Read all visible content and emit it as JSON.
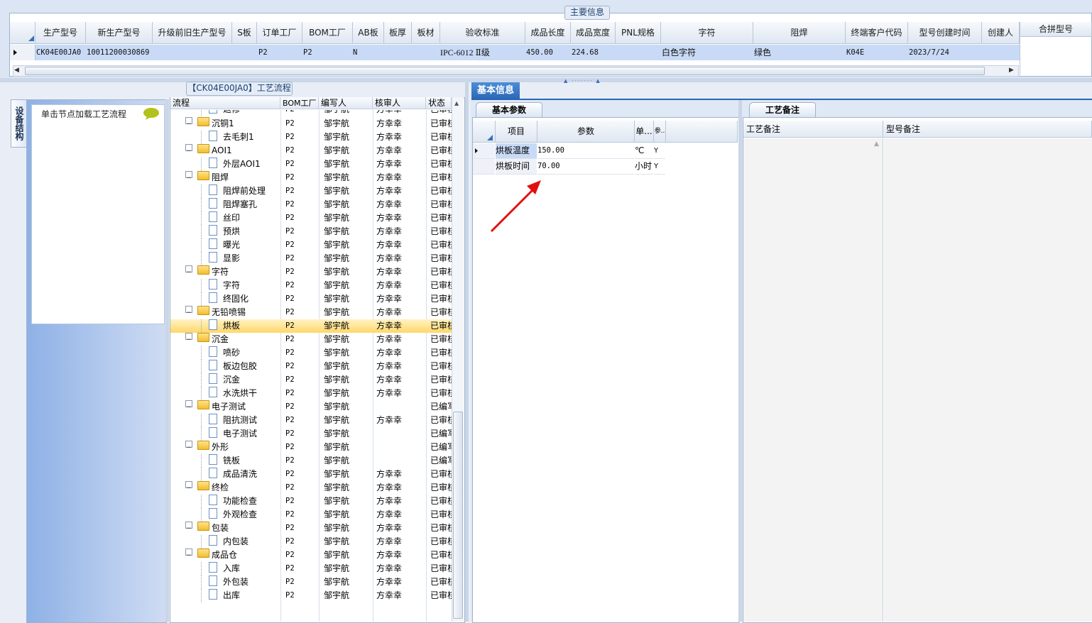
{
  "main_info": {
    "legend": "主要信息",
    "columns": [
      "生产型号",
      "新生产型号",
      "升级前旧生产型号",
      "S板",
      "订单工厂",
      "BOM工厂",
      "AB板",
      "板厚",
      "板材",
      "验收标准",
      "成品长度",
      "成品宽度",
      "PNL规格",
      "字符",
      "阻焊",
      "终端客户代码",
      "型号创建时间",
      "创建人"
    ],
    "row": {
      "production_model": "CK04E00JA0",
      "new_production_model": "10011200030869",
      "order_factory": "P2",
      "bom_factory": "P2",
      "ab_board": "N",
      "acceptance_standard": "IPC-6012 Ⅱ级",
      "length": "450.00",
      "width": "224.68",
      "character": "白色字符",
      "solder_mask": "绿色",
      "customer_code": "K04E",
      "created": "2023/7/24"
    },
    "merge_model_header": "合拼型号"
  },
  "left_panel": {
    "tab_label": "设备结构",
    "hint": "单击节点加载工艺流程"
  },
  "process_flow": {
    "legend": "【CK04E00JA0】工艺流程",
    "columns": [
      "流程",
      "BOM工厂",
      "编写人",
      "核审人",
      "状态"
    ],
    "rows": [
      {
        "level": 2,
        "type": "doc",
        "name": "返修",
        "bom": "P2",
        "writer": "邹宇航",
        "reviewer": "方幸幸",
        "status": "已审核",
        "partial": true
      },
      {
        "level": 1,
        "type": "folder",
        "name": "沉铜1",
        "bom": "P2",
        "writer": "邹宇航",
        "reviewer": "方幸幸",
        "status": "已审核"
      },
      {
        "level": 2,
        "type": "doc",
        "name": "去毛刺1",
        "bom": "P2",
        "writer": "邹宇航",
        "reviewer": "方幸幸",
        "status": "已审核"
      },
      {
        "level": 1,
        "type": "folder",
        "name": "AOI1",
        "bom": "P2",
        "writer": "邹宇航",
        "reviewer": "方幸幸",
        "status": "已审核"
      },
      {
        "level": 2,
        "type": "doc",
        "name": "外层AOI1",
        "bom": "P2",
        "writer": "邹宇航",
        "reviewer": "方幸幸",
        "status": "已审核"
      },
      {
        "level": 1,
        "type": "folder",
        "name": "阻焊",
        "bom": "P2",
        "writer": "邹宇航",
        "reviewer": "方幸幸",
        "status": "已审核"
      },
      {
        "level": 2,
        "type": "doc",
        "name": "阻焊前处理",
        "bom": "P2",
        "writer": "邹宇航",
        "reviewer": "方幸幸",
        "status": "已审核"
      },
      {
        "level": 2,
        "type": "doc",
        "name": "阻焊塞孔",
        "bom": "P2",
        "writer": "邹宇航",
        "reviewer": "方幸幸",
        "status": "已审核"
      },
      {
        "level": 2,
        "type": "doc",
        "name": "丝印",
        "bom": "P2",
        "writer": "邹宇航",
        "reviewer": "方幸幸",
        "status": "已审核"
      },
      {
        "level": 2,
        "type": "doc",
        "name": "预烘",
        "bom": "P2",
        "writer": "邹宇航",
        "reviewer": "方幸幸",
        "status": "已审核"
      },
      {
        "level": 2,
        "type": "doc",
        "name": "曝光",
        "bom": "P2",
        "writer": "邹宇航",
        "reviewer": "方幸幸",
        "status": "已审核"
      },
      {
        "level": 2,
        "type": "doc",
        "name": "显影",
        "bom": "P2",
        "writer": "邹宇航",
        "reviewer": "方幸幸",
        "status": "已审核"
      },
      {
        "level": 1,
        "type": "folder",
        "name": "字符",
        "bom": "P2",
        "writer": "邹宇航",
        "reviewer": "方幸幸",
        "status": "已审核"
      },
      {
        "level": 2,
        "type": "doc",
        "name": "字符",
        "bom": "P2",
        "writer": "邹宇航",
        "reviewer": "方幸幸",
        "status": "已审核"
      },
      {
        "level": 2,
        "type": "doc",
        "name": "终固化",
        "bom": "P2",
        "writer": "邹宇航",
        "reviewer": "方幸幸",
        "status": "已审核"
      },
      {
        "level": 1,
        "type": "folder",
        "name": "无铅喷锡",
        "bom": "P2",
        "writer": "邹宇航",
        "reviewer": "方幸幸",
        "status": "已审核"
      },
      {
        "level": 2,
        "type": "doc",
        "name": "烘板",
        "bom": "P2",
        "writer": "邹宇航",
        "reviewer": "方幸幸",
        "status": "已审核",
        "selected": true
      },
      {
        "level": 1,
        "type": "folder",
        "name": "沉金",
        "bom": "P2",
        "writer": "邹宇航",
        "reviewer": "方幸幸",
        "status": "已审核"
      },
      {
        "level": 2,
        "type": "doc",
        "name": "喷砂",
        "bom": "P2",
        "writer": "邹宇航",
        "reviewer": "方幸幸",
        "status": "已审核"
      },
      {
        "level": 2,
        "type": "doc",
        "name": "板边包胶",
        "bom": "P2",
        "writer": "邹宇航",
        "reviewer": "方幸幸",
        "status": "已审核"
      },
      {
        "level": 2,
        "type": "doc",
        "name": "沉金",
        "bom": "P2",
        "writer": "邹宇航",
        "reviewer": "方幸幸",
        "status": "已审核"
      },
      {
        "level": 2,
        "type": "doc",
        "name": "水洗烘干",
        "bom": "P2",
        "writer": "邹宇航",
        "reviewer": "方幸幸",
        "status": "已审核"
      },
      {
        "level": 1,
        "type": "folder",
        "name": "电子测试",
        "bom": "P2",
        "writer": "邹宇航",
        "reviewer": "",
        "status": "已编写"
      },
      {
        "level": 2,
        "type": "doc",
        "name": "阻抗测试",
        "bom": "P2",
        "writer": "邹宇航",
        "reviewer": "方幸幸",
        "status": "已审核"
      },
      {
        "level": 2,
        "type": "doc",
        "name": "电子测试",
        "bom": "P2",
        "writer": "邹宇航",
        "reviewer": "",
        "status": "已编写"
      },
      {
        "level": 1,
        "type": "folder",
        "name": "外形",
        "bom": "P2",
        "writer": "邹宇航",
        "reviewer": "",
        "status": "已编写"
      },
      {
        "level": 2,
        "type": "doc",
        "name": "铣板",
        "bom": "P2",
        "writer": "邹宇航",
        "reviewer": "",
        "status": "已编写"
      },
      {
        "level": 2,
        "type": "doc",
        "name": "成品清洗",
        "bom": "P2",
        "writer": "邹宇航",
        "reviewer": "方幸幸",
        "status": "已审核"
      },
      {
        "level": 1,
        "type": "folder",
        "name": "终检",
        "bom": "P2",
        "writer": "邹宇航",
        "reviewer": "方幸幸",
        "status": "已审核"
      },
      {
        "level": 2,
        "type": "doc",
        "name": "功能检查",
        "bom": "P2",
        "writer": "邹宇航",
        "reviewer": "方幸幸",
        "status": "已审核"
      },
      {
        "level": 2,
        "type": "doc",
        "name": "外观检查",
        "bom": "P2",
        "writer": "邹宇航",
        "reviewer": "方幸幸",
        "status": "已审核"
      },
      {
        "level": 1,
        "type": "folder",
        "name": "包装",
        "bom": "P2",
        "writer": "邹宇航",
        "reviewer": "方幸幸",
        "status": "已审核"
      },
      {
        "level": 2,
        "type": "doc",
        "name": "内包装",
        "bom": "P2",
        "writer": "邹宇航",
        "reviewer": "方幸幸",
        "status": "已审核"
      },
      {
        "level": 1,
        "type": "folder",
        "name": "成品仓",
        "bom": "P2",
        "writer": "邹宇航",
        "reviewer": "方幸幸",
        "status": "已审核"
      },
      {
        "level": 2,
        "type": "doc",
        "name": "入库",
        "bom": "P2",
        "writer": "邹宇航",
        "reviewer": "方幸幸",
        "status": "已审核"
      },
      {
        "level": 2,
        "type": "doc",
        "name": "外包装",
        "bom": "P2",
        "writer": "邹宇航",
        "reviewer": "方幸幸",
        "status": "已审核"
      },
      {
        "level": 2,
        "type": "doc",
        "name": "出库",
        "bom": "P2",
        "writer": "邹宇航",
        "reviewer": "方幸幸",
        "status": "已审核"
      }
    ]
  },
  "basic_info": {
    "tab": "基本信息",
    "param_tab": "基本参数",
    "param_columns": [
      "项目",
      "参数",
      "单...",
      "参.."
    ],
    "params": [
      {
        "item": "烘板温度",
        "value": "150.00",
        "unit": "℃",
        "flag": "Y"
      },
      {
        "item": "烘板时间",
        "value": "70.00",
        "unit": "小时",
        "flag": "Y"
      }
    ],
    "remark_tab": "工艺备注",
    "remark_columns": [
      "工艺备注",
      "型号备注"
    ]
  },
  "colors": {
    "selection": "#c8daf6",
    "accent": "#2a66b5",
    "arrow": "#e01010"
  }
}
